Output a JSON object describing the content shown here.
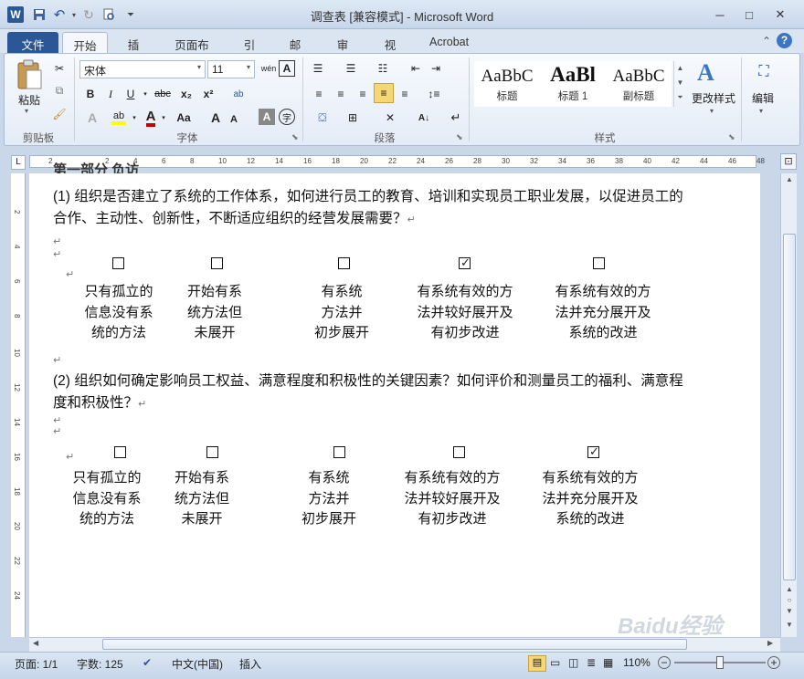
{
  "window": {
    "title": "调查表 [兼容模式] - Microsoft Word",
    "app_icon": "W",
    "minimize": "─",
    "maximize": "□",
    "close": "✕"
  },
  "tabs": [
    "文件",
    "开始",
    "插入",
    "页面布局",
    "引用",
    "邮件",
    "审阅",
    "视图",
    "Acrobat"
  ],
  "ribbon": {
    "clipboard": {
      "paste": "粘贴",
      "label": "剪贴板"
    },
    "font": {
      "name": "宋体",
      "size": "11",
      "label": "字体",
      "bold": "B",
      "italic": "I",
      "underline": "U",
      "strike": "abc",
      "sub": "x₂",
      "sup": "x²",
      "grow": "A",
      "shrink": "A",
      "case": "Aa",
      "clear": "A",
      "char": "A",
      "circle": "字",
      "phonetic": "wén",
      "border_a": "A"
    },
    "paragraph": {
      "label": "段落"
    },
    "styles": {
      "label": "样式",
      "items": [
        {
          "sample": "AaBbC",
          "name": "标题"
        },
        {
          "sample": "AaBl",
          "name": "标题 1"
        },
        {
          "sample": "AaBbC",
          "name": "副标题"
        }
      ],
      "change": "更改样式"
    },
    "editing": {
      "label": "编辑"
    }
  },
  "ruler": {
    "numbers": [
      "2",
      "",
      "2",
      "4",
      "6",
      "8",
      "10",
      "12",
      "14",
      "16",
      "18",
      "20",
      "22",
      "24",
      "26",
      "28",
      "30",
      "32",
      "34",
      "36",
      "38",
      "40",
      "42",
      "44",
      "46",
      "48"
    ],
    "vnumbers": [
      "2",
      "4",
      "6",
      "8",
      "10",
      "12",
      "14",
      "16",
      "18",
      "20",
      "22",
      "24"
    ]
  },
  "document": {
    "header_fragment": "第一部分  负访",
    "q1": "(1) 组织是否建立了系统的工作体系，如何进行员工的教育、培训和实现员工职业发展，以促进员工的合作、主动性、创新性，不断适应组织的经营发展需要？",
    "q1_options": [
      {
        "lines": [
          "只有孤立的",
          "信息没有系",
          "统的方法"
        ],
        "checked": false
      },
      {
        "lines": [
          "开始有系",
          "统方法但",
          "未展开"
        ],
        "checked": false
      },
      {
        "lines": [
          "有系统",
          "方法并",
          "初步展开"
        ],
        "checked": false
      },
      {
        "lines": [
          "有系统有效的方",
          "法并较好展开及",
          "有初步改进"
        ],
        "checked": true
      },
      {
        "lines": [
          "有系统有效的方",
          "法并充分展开及",
          "系统的改进"
        ],
        "checked": false
      }
    ],
    "q2": "(2) 组织如何确定影响员工权益、满意程度和积极性的关键因素？如何评价和测量员工的福利、满意程度和积极性？",
    "q2_options": [
      {
        "lines": [
          "只有孤立的",
          "信息没有系",
          "统的方法"
        ],
        "checked": false
      },
      {
        "lines": [
          "开始有系",
          "统方法但",
          "未展开"
        ],
        "checked": false
      },
      {
        "lines": [
          "有系统",
          "方法并",
          "初步展开"
        ],
        "checked": false
      },
      {
        "lines": [
          "有系统有效的方",
          "法并较好展开及",
          "有初步改进"
        ],
        "checked": false
      },
      {
        "lines": [
          "有系统有效的方",
          "法并充分展开及",
          "系统的改进"
        ],
        "checked": true
      }
    ],
    "box_unchecked": "☐",
    "box_checked": "☑",
    "para_mark": "↵"
  },
  "status": {
    "page": "页面: 1/1",
    "words": "字数: 125",
    "lang": "中文(中国)",
    "mode": "插入",
    "zoom": "110%"
  },
  "watermark": "Baidu经验",
  "colors": {
    "file_tab": "#2b5797",
    "font_red": "#c00000",
    "highlight": "#ffff00"
  }
}
